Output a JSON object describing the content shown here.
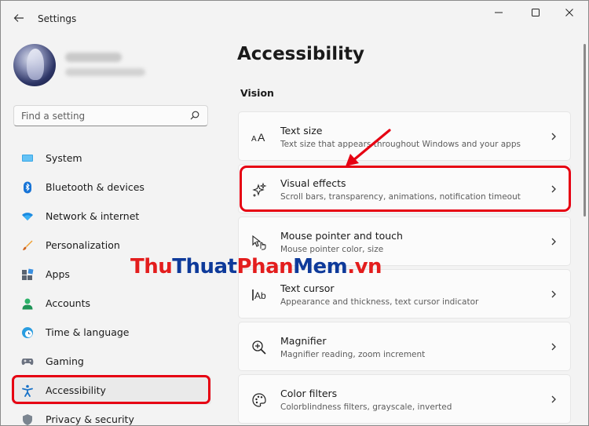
{
  "window": {
    "title": "Settings",
    "back_icon": "arrow-left-icon",
    "controls": [
      "minimize-icon",
      "maximize-icon",
      "close-icon"
    ]
  },
  "search": {
    "placeholder": "Find a setting",
    "icon": "search-icon"
  },
  "sidebar": {
    "items": [
      {
        "label": "System",
        "icon": "monitor-icon",
        "active": false
      },
      {
        "label": "Bluetooth & devices",
        "icon": "bluetooth-icon",
        "active": false
      },
      {
        "label": "Network & internet",
        "icon": "wifi-icon",
        "active": false
      },
      {
        "label": "Personalization",
        "icon": "brush-icon",
        "active": false
      },
      {
        "label": "Apps",
        "icon": "apps-icon",
        "active": false
      },
      {
        "label": "Accounts",
        "icon": "person-icon",
        "active": false
      },
      {
        "label": "Time & language",
        "icon": "clock-globe-icon",
        "active": false
      },
      {
        "label": "Gaming",
        "icon": "gamepad-icon",
        "active": false
      },
      {
        "label": "Accessibility",
        "icon": "accessibility-icon",
        "active": true
      },
      {
        "label": "Privacy & security",
        "icon": "shield-icon",
        "active": false
      }
    ]
  },
  "main": {
    "title": "Accessibility",
    "section": "Vision",
    "cards": [
      {
        "title": "Text size",
        "desc": "Text size that appears throughout Windows and your apps",
        "icon": "text-size-icon"
      },
      {
        "title": "Visual effects",
        "desc": "Scroll bars, transparency, animations, notification timeout",
        "icon": "sparkle-icon"
      },
      {
        "title": "Mouse pointer and touch",
        "desc": "Mouse pointer color, size",
        "icon": "mouse-pointer-icon"
      },
      {
        "title": "Text cursor",
        "desc": "Appearance and thickness, text cursor indicator",
        "icon": "text-cursor-icon"
      },
      {
        "title": "Magnifier",
        "desc": "Magnifier reading, zoom increment",
        "icon": "magnifier-icon"
      },
      {
        "title": "Color filters",
        "desc": "Colorblindness filters, grayscale, inverted",
        "icon": "palette-icon"
      }
    ]
  },
  "watermark": {
    "part1": "Thu",
    "part2": "Thuat",
    "part3": "Phan",
    "part4": "Mem",
    "part5": ".vn"
  },
  "colors": {
    "accent": "#0067c0",
    "highlight": "#e60012"
  }
}
